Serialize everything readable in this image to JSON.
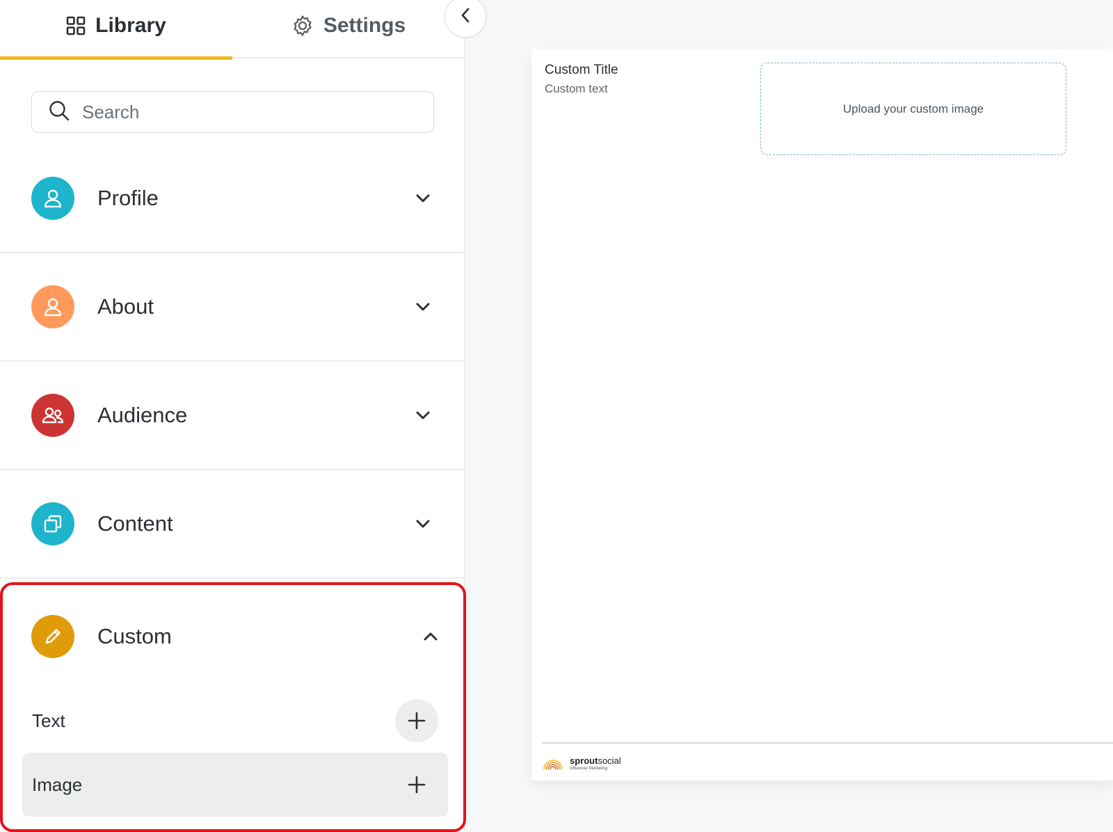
{
  "tabs": {
    "library_label": "Library",
    "settings_label": "Settings",
    "active": "Library",
    "accent_color": "#f2b91f"
  },
  "search": {
    "placeholder": "Search",
    "value": ""
  },
  "sections": [
    {
      "label": "Profile",
      "icon": "user-icon",
      "color": "#1eb4cc",
      "expanded": false
    },
    {
      "label": "About",
      "icon": "user-icon",
      "color": "#ff9a5c",
      "expanded": false
    },
    {
      "label": "Audience",
      "icon": "users-icon",
      "color": "#cc3333",
      "expanded": false
    },
    {
      "label": "Content",
      "icon": "copy-icon",
      "color": "#1eb4cc",
      "expanded": false
    },
    {
      "label": "Custom",
      "icon": "pencil-icon",
      "color": "#e09b0b",
      "expanded": true
    }
  ],
  "custom_items": [
    {
      "label": "Text",
      "icon": "plus-icon"
    },
    {
      "label": "Image",
      "icon": "plus-icon"
    }
  ],
  "highlight_color": "#e4131b",
  "preview": {
    "title": "Custom Title",
    "text": "Custom text",
    "upload_label": "Upload your custom image"
  },
  "footer": {
    "brand_bold": "sprout",
    "brand_regular": "social",
    "tagline": "Influencer Marketing"
  }
}
